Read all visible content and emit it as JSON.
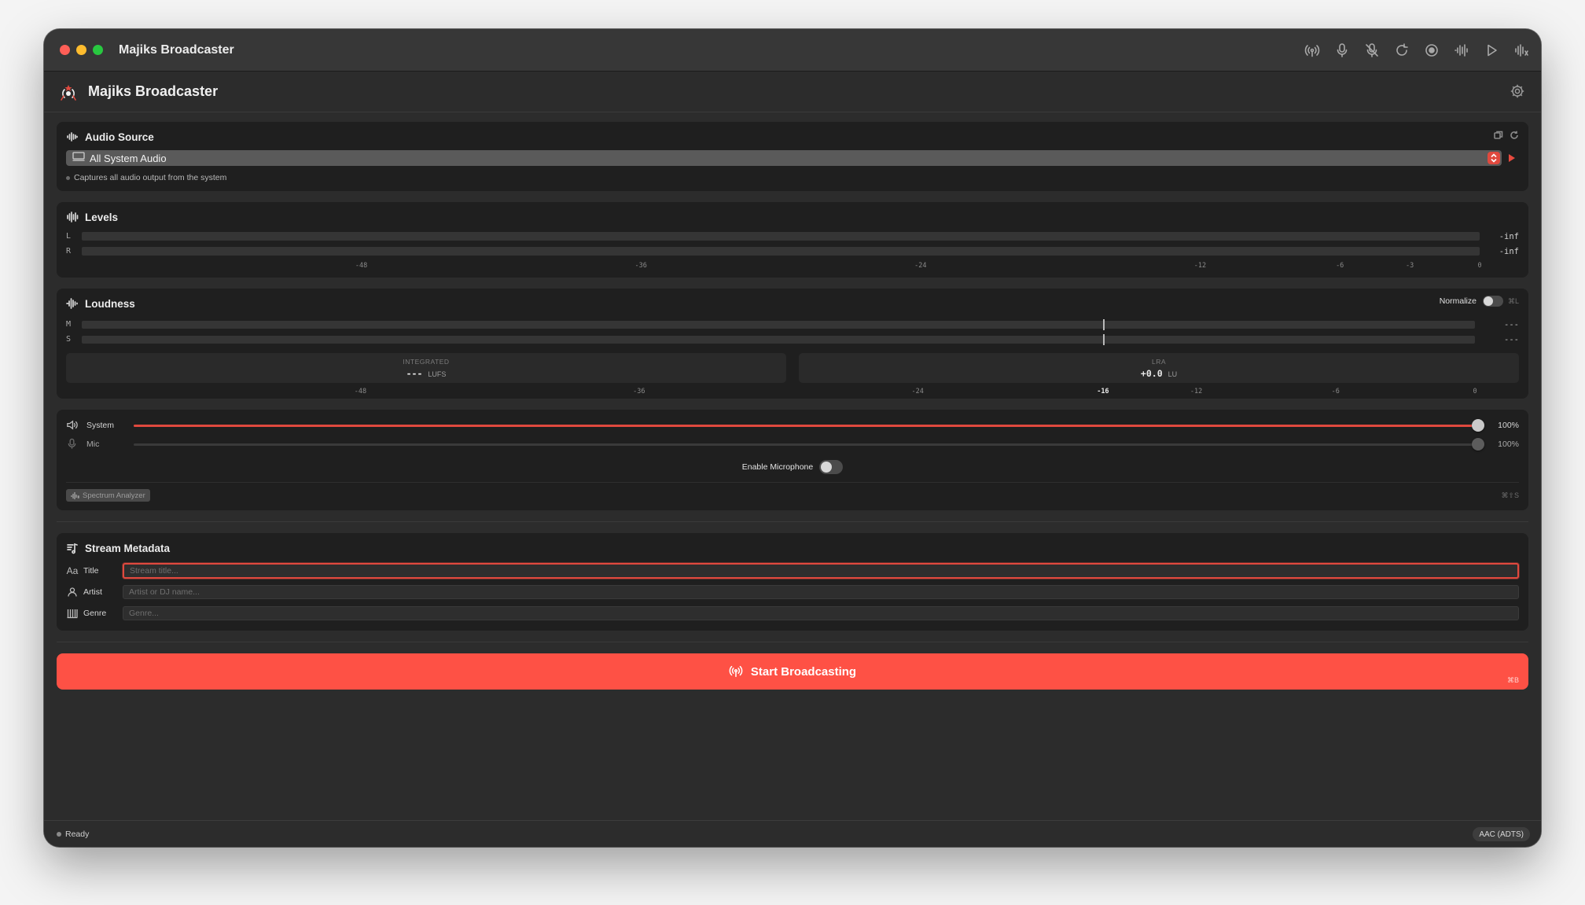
{
  "window": {
    "title": "Majiks Broadcaster",
    "toolbar_icons": [
      "broadcast-icon",
      "mic-icon",
      "mic-off-icon",
      "refresh-icon",
      "record-icon",
      "waveform-icon",
      "play-icon",
      "levels-icon"
    ]
  },
  "header": {
    "app_title": "Majiks Broadcaster",
    "settings_icon": "gear-icon"
  },
  "audio_source": {
    "title": "Audio Source",
    "selected": "All System Audio",
    "hint": "Captures all audio output from the system"
  },
  "levels": {
    "title": "Levels",
    "channels": [
      {
        "label": "L",
        "value": "-inf"
      },
      {
        "label": "R",
        "value": "-inf"
      }
    ],
    "scale": [
      "-48",
      "-36",
      "-24",
      "-12",
      "-6",
      "-3",
      "0"
    ]
  },
  "loudness": {
    "title": "Loudness",
    "normalize_label": "Normalize",
    "normalize_shortcut": "⌘L",
    "normalize_on": false,
    "meters": [
      {
        "label": "M",
        "value": "---"
      },
      {
        "label": "S",
        "value": "---"
      }
    ],
    "target_lufs": -16,
    "integrated": {
      "label": "INTEGRATED",
      "value": "---",
      "unit": "LUFS"
    },
    "lra": {
      "label": "LRA",
      "value": "+0.0",
      "unit": "LU"
    },
    "scale": [
      "-48",
      "-36",
      "-24",
      "-16",
      "-12",
      "-6",
      "0"
    ]
  },
  "mixer": {
    "channels": [
      {
        "label": "System",
        "value": "100%",
        "level": 1.0,
        "active": true
      },
      {
        "label": "Mic",
        "value": "100%",
        "level": 1.0,
        "active": false
      }
    ],
    "mic_toggle_label": "Enable Microphone",
    "mic_enabled": false,
    "spectrum_label": "Spectrum Analyzer",
    "spectrum_shortcut": "⌘⇧S"
  },
  "metadata": {
    "title": "Stream Metadata",
    "fields": [
      {
        "label": "Title",
        "icon": "text-icon",
        "placeholder": "Stream title...",
        "value": ""
      },
      {
        "label": "Artist",
        "icon": "person-icon",
        "placeholder": "Artist or DJ name...",
        "value": ""
      },
      {
        "label": "Genre",
        "icon": "genre-icon",
        "placeholder": "Genre...",
        "value": ""
      }
    ]
  },
  "broadcast": {
    "label": "Start Broadcasting",
    "shortcut": "⌘B",
    "color": "#fe5145"
  },
  "status": {
    "text": "Ready",
    "codec": "AAC (ADTS)"
  },
  "colors": {
    "accent": "#e0493e",
    "window_bg": "#2c2c2c",
    "panel_bg": "#1f1f1f"
  }
}
